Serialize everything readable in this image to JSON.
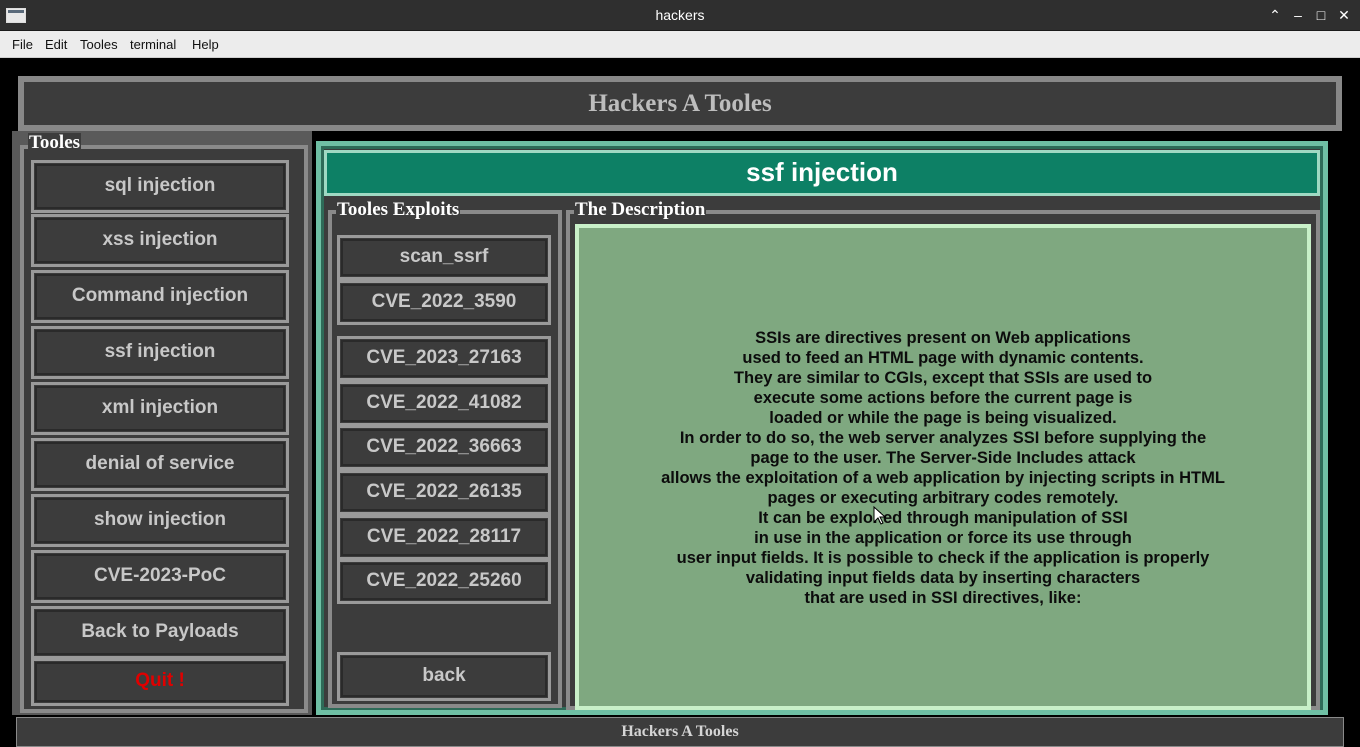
{
  "window": {
    "title": "hackers"
  },
  "menubar": {
    "items": [
      "File",
      "Edit",
      "Tooles",
      "terminal",
      "Help"
    ]
  },
  "header": {
    "title": "Hackers A Tooles"
  },
  "left_panel": {
    "legend": "Tooles",
    "buttons": [
      "sql injection",
      "xss injection",
      "Command injection",
      "ssf injection",
      "xml injection",
      "denial of service",
      "show injection",
      "CVE-2023-PoC",
      "Back to Payloads"
    ],
    "quit_label": "Quit !"
  },
  "main": {
    "title": "ssf injection",
    "exploits": {
      "legend": "Tooles Exploits",
      "buttons": [
        "scan_ssrf",
        "CVE_2022_3590",
        "CVE_2023_27163",
        "CVE_2022_41082",
        "CVE_2022_36663",
        "CVE_2022_26135",
        "CVE_2022_28117",
        "CVE_2022_25260"
      ],
      "back_label": "back"
    },
    "description": {
      "legend": "The Description",
      "text": "SSIs are directives present on Web applications\nused to feed an HTML page with dynamic contents.\nThey are similar to CGIs, except that SSIs are used to\nexecute some actions before the current page is\nloaded or while the page is being visualized.\nIn order to do so, the web server analyzes SSI before supplying the\npage to the user. The Server-Side Includes attack\nallows the exploitation of a web application by injecting scripts in HTML\npages or executing arbitrary codes remotely.\nIt can be exploited through manipulation of SSI\nin use in the application or force its use through\nuser input fields. It is possible to check if the application is properly\nvalidating input fields data by inserting characters\nthat are used in SSI directives, like:"
    }
  },
  "statusbar": {
    "text": "Hackers A Tooles"
  },
  "colors": {
    "accent": "#0d8065",
    "panel_bg": "#3c3c3c",
    "desc_bg": "#7fa880",
    "quit": "#e00000"
  }
}
